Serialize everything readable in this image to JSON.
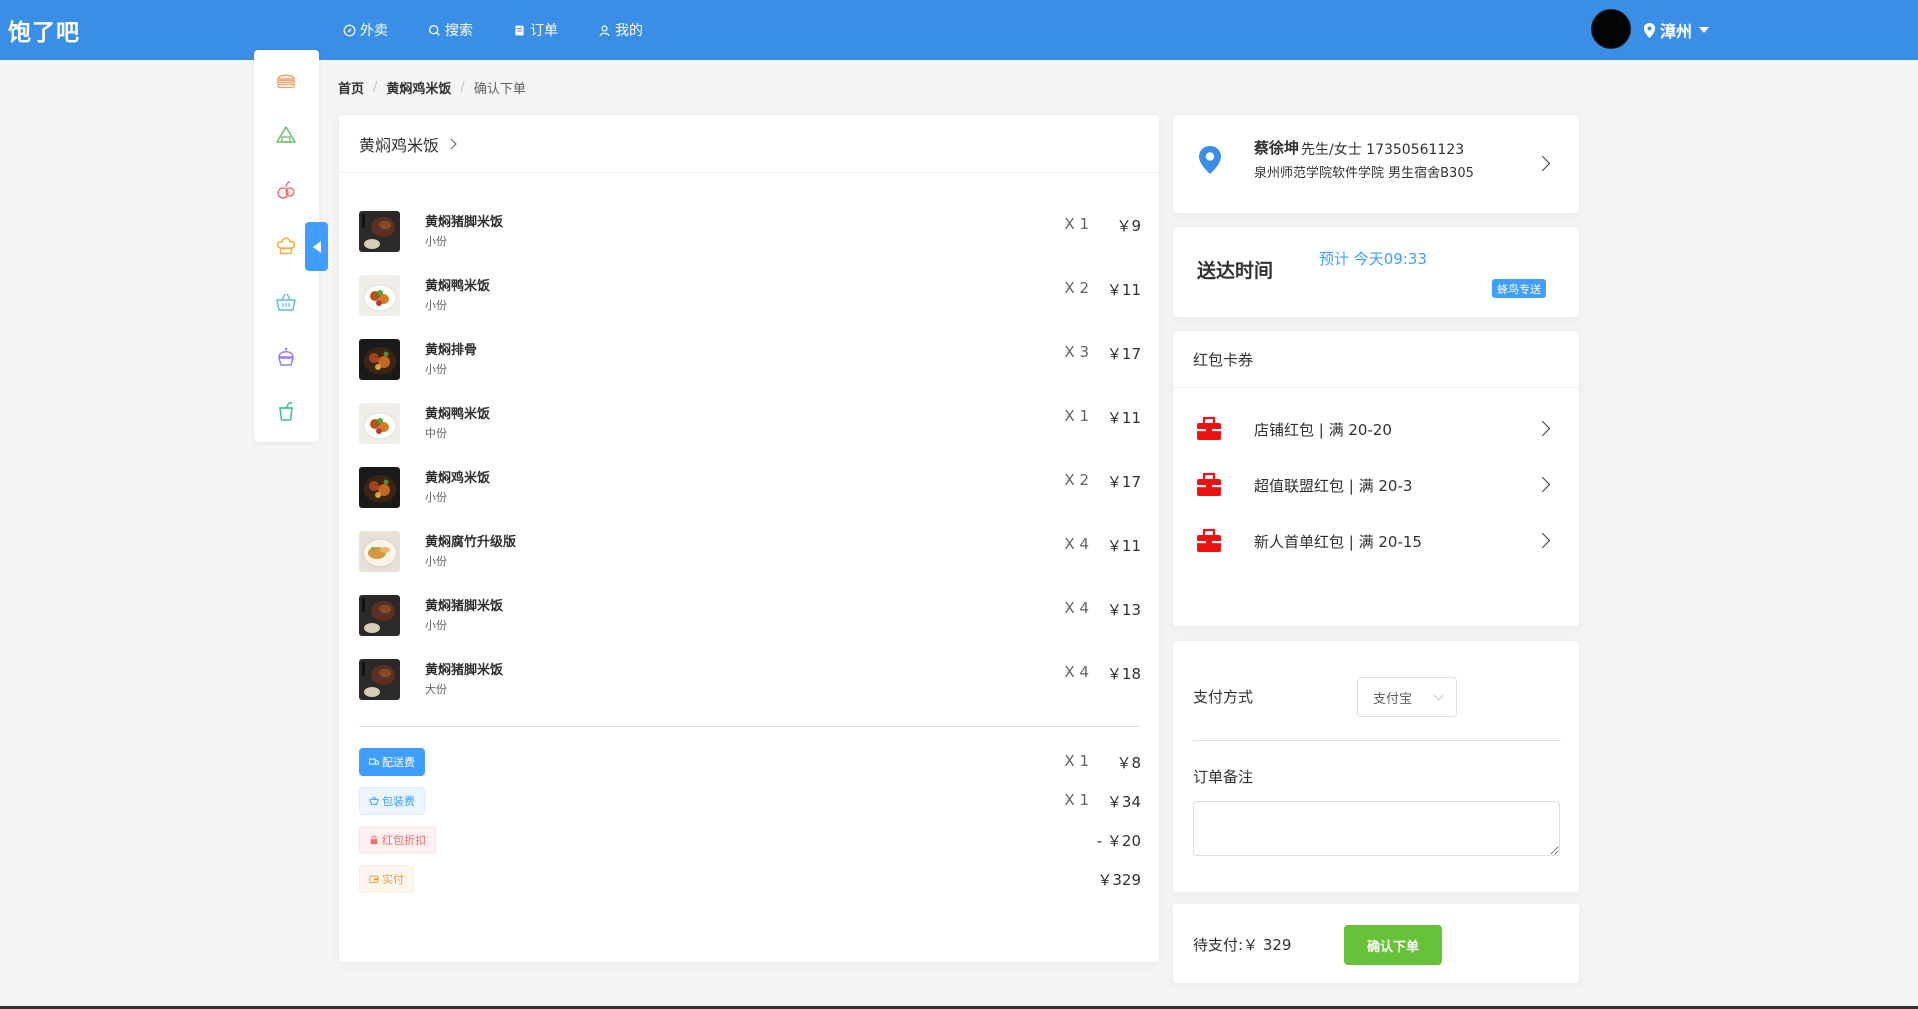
{
  "header": {
    "logo": "饱了吧",
    "nav": [
      {
        "label": "外卖",
        "icon": "compass-icon"
      },
      {
        "label": "搜索",
        "icon": "search-icon"
      },
      {
        "label": "订单",
        "icon": "document-icon"
      },
      {
        "label": "我的",
        "icon": "user-icon"
      }
    ],
    "city": "漳州",
    "accent_color": "#3a8ee6"
  },
  "sidebar": {
    "icons": [
      "burger-icon",
      "rice-ball-icon",
      "fruit-icon",
      "chef-hat-icon",
      "basket-icon",
      "cupcake-icon",
      "drink-icon"
    ]
  },
  "breadcrumb": {
    "home": "首页",
    "shop": "黄焖鸡米饭",
    "current": "确认下单",
    "sep": "/"
  },
  "order": {
    "shop_name": "黄焖鸡米饭",
    "items": [
      {
        "name": "黄焖猪脚米饭",
        "spec": "小份",
        "qty": "X 1",
        "price": "￥9",
        "thumb": "dark"
      },
      {
        "name": "黄焖鸭米饭",
        "spec": "小份",
        "qty": "X 2",
        "price": "￥11",
        "thumb": "food"
      },
      {
        "name": "黄焖排骨",
        "spec": "小份",
        "qty": "X 3",
        "price": "￥17",
        "thumb": "stew"
      },
      {
        "name": "黄焖鸭米饭",
        "spec": "中份",
        "qty": "X 1",
        "price": "￥11",
        "thumb": "food"
      },
      {
        "name": "黄焖鸡米饭",
        "spec": "小份",
        "qty": "X 2",
        "price": "￥17",
        "thumb": "stew"
      },
      {
        "name": "黄焖腐竹升级版",
        "spec": "小份",
        "qty": "X 4",
        "price": "￥11",
        "thumb": "light"
      },
      {
        "name": "黄焖猪脚米饭",
        "spec": "小份",
        "qty": "X 4",
        "price": "￥13",
        "thumb": "dark"
      },
      {
        "name": "黄焖猪脚米饭",
        "spec": "大份",
        "qty": "X 4",
        "price": "￥18",
        "thumb": "dark"
      }
    ],
    "fees": [
      {
        "label": "配送费",
        "qty": "X 1",
        "price": "￥8",
        "style": "tag-blue-solid",
        "icon": "truck-icon"
      },
      {
        "label": "包装费",
        "qty": "X 1",
        "price": "￥34",
        "style": "tag-blue",
        "icon": "package-icon"
      },
      {
        "label": "红包折扣",
        "qty": "",
        "price": "- ￥20",
        "style": "tag-red",
        "icon": "lock-icon"
      },
      {
        "label": "实付",
        "qty": "",
        "price": "￥329",
        "style": "tag-orange",
        "icon": "wallet-icon"
      }
    ]
  },
  "address": {
    "name": "蔡徐坤",
    "title": "先生/女士 17350561123",
    "line": "泉州师范学院软件学院 男生宿舍B305"
  },
  "delivery": {
    "label": "送达时间",
    "estimate": "预计 今天09:33",
    "badge": "蜂鸟专送"
  },
  "coupons": {
    "title": "红包卡券",
    "items": [
      "店铺红包 | 满 20-20",
      "超值联盟红包 | 满 20-3",
      "新人首单红包 | 满 20-15"
    ]
  },
  "payment": {
    "label": "支付方式",
    "method": "支付宝",
    "note_label": "订单备注",
    "note_value": ""
  },
  "submit": {
    "total_label": "待支付:￥ 329",
    "button": "确认下单"
  }
}
